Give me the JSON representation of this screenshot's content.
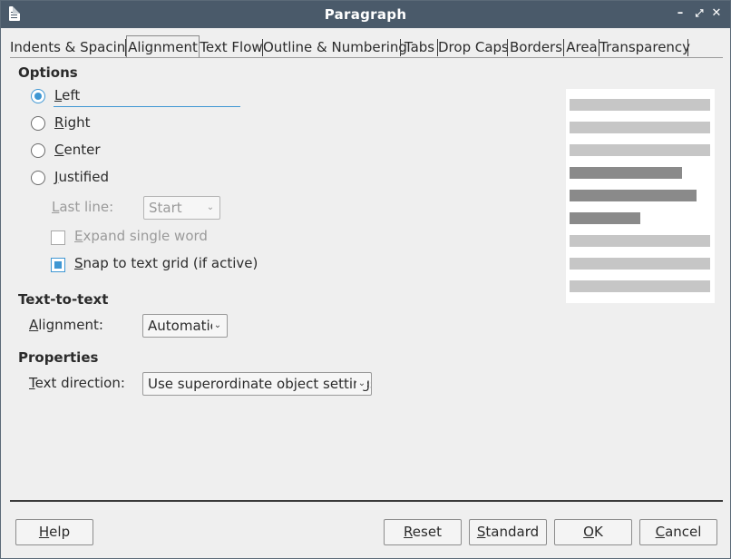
{
  "window": {
    "title": "Paragraph"
  },
  "tabs": [
    {
      "label": "Indents & Spacing"
    },
    {
      "label": "Alignment"
    },
    {
      "label": "Text Flow"
    },
    {
      "label": "Outline & Numbering"
    },
    {
      "label": "Tabs"
    },
    {
      "label": "Drop Caps"
    },
    {
      "label": "Borders"
    },
    {
      "label": "Area"
    },
    {
      "label": "Transparency"
    }
  ],
  "active_tab": "Alignment",
  "options": {
    "heading": "Options",
    "radios": [
      {
        "first": "L",
        "rest": "eft",
        "checked": true
      },
      {
        "first": "R",
        "rest": "ight",
        "checked": false
      },
      {
        "first": "C",
        "rest": "enter",
        "checked": false
      },
      {
        "first": "J",
        "rest": "ustified",
        "checked": false
      }
    ],
    "last_line": {
      "first": "L",
      "rest": "ast line:",
      "value": "Start"
    },
    "expand": {
      "first": "E",
      "rest": "xpand single word",
      "checked": false,
      "disabled": true
    },
    "snap": {
      "first": "S",
      "rest": "nap to text grid (if active)",
      "checked": true
    }
  },
  "text_to_text": {
    "heading": "Text-to-text",
    "label_first": "A",
    "label_rest": "lignment:",
    "value": "Automatic"
  },
  "properties": {
    "heading": "Properties",
    "label_first": "T",
    "label_rest": "ext direction:",
    "value": "Use superordinate object settings"
  },
  "preview": {
    "line_fill": [
      1.0,
      1.0,
      1.0,
      0.8,
      0.9,
      0.5,
      1.0,
      1.0,
      1.0
    ],
    "line_highlight": [
      false,
      false,
      false,
      true,
      true,
      true,
      false,
      false,
      false
    ],
    "colors": {
      "normal": "#c6c6c6",
      "highlight": "#8a8a8a",
      "background": "#ffffff"
    }
  },
  "buttons": {
    "help": {
      "first": "H",
      "rest": "elp"
    },
    "reset": {
      "first": "R",
      "rest": "eset"
    },
    "standard": {
      "first": "S",
      "rest": "tandard"
    },
    "ok": {
      "first": "O",
      "rest": "K"
    },
    "cancel": {
      "first": "C",
      "rest": "ancel"
    }
  },
  "colors": {
    "titlebar": "#4a5a6a",
    "accent": "#3f97d3",
    "dialog_bg": "#efefef"
  }
}
